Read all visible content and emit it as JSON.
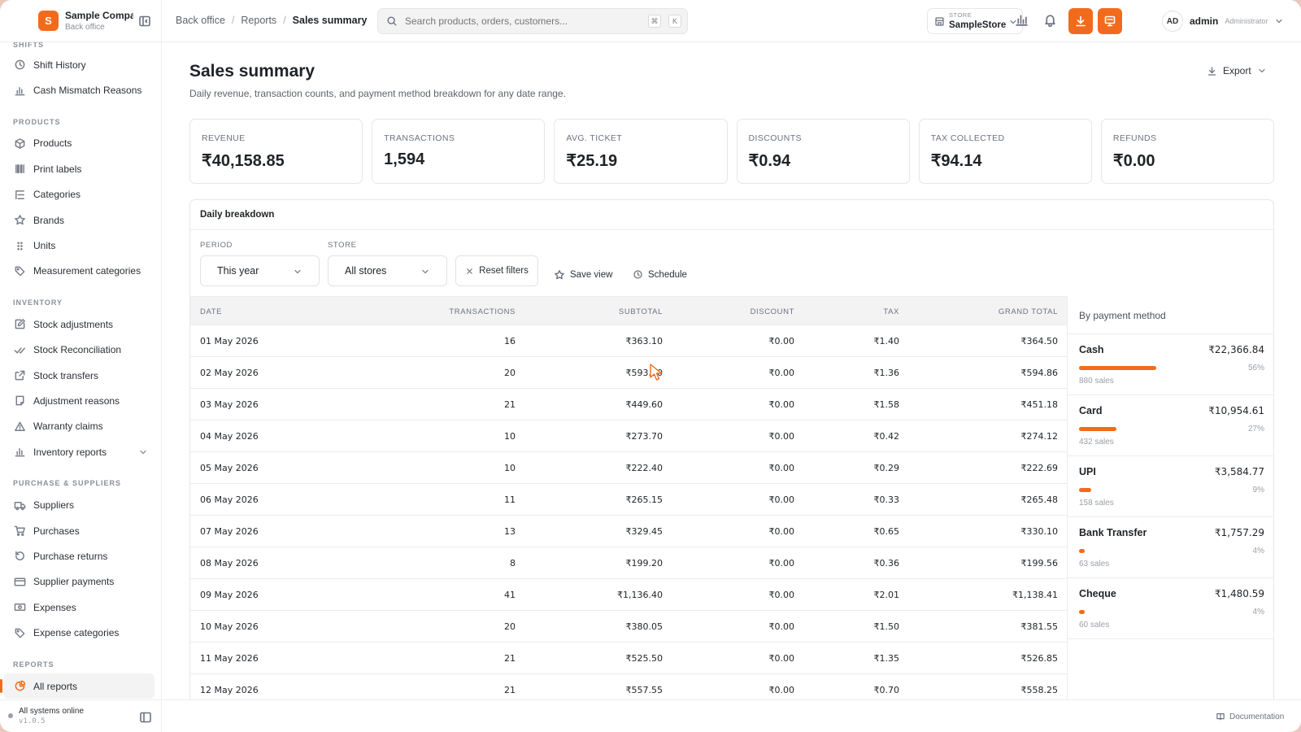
{
  "brand": {
    "initial": "S",
    "name": "Sample Company",
    "sub": "Back office"
  },
  "sidebar": {
    "sections": [
      {
        "label": "Shifts",
        "items": [
          {
            "label": "Shift History",
            "icon": "clock-icon"
          },
          {
            "label": "Cash Mismatch Reasons",
            "icon": "bar-chart-icon"
          }
        ]
      },
      {
        "label": "Products",
        "items": [
          {
            "label": "Products",
            "icon": "box-icon"
          },
          {
            "label": "Print labels",
            "icon": "barcode-icon"
          },
          {
            "label": "Categories",
            "icon": "list-tree-icon"
          },
          {
            "label": "Brands",
            "icon": "star-icon"
          },
          {
            "label": "Units",
            "icon": "grid-dots-icon"
          },
          {
            "label": "Measurement categories",
            "icon": "tag-icon"
          }
        ]
      },
      {
        "label": "Inventory",
        "items": [
          {
            "label": "Stock adjustments",
            "icon": "edit-icon"
          },
          {
            "label": "Stock Reconciliation",
            "icon": "check-check-icon"
          },
          {
            "label": "Stock transfers",
            "icon": "external-link-icon"
          },
          {
            "label": "Adjustment reasons",
            "icon": "note-icon"
          },
          {
            "label": "Warranty claims",
            "icon": "warning-icon"
          },
          {
            "label": "Inventory reports",
            "icon": "bar-chart-icon",
            "expandable": true
          }
        ]
      },
      {
        "label": "Purchase & Suppliers",
        "items": [
          {
            "label": "Suppliers",
            "icon": "truck-icon"
          },
          {
            "label": "Purchases",
            "icon": "cart-icon"
          },
          {
            "label": "Purchase returns",
            "icon": "undo-icon"
          },
          {
            "label": "Supplier payments",
            "icon": "card-icon"
          },
          {
            "label": "Expenses",
            "icon": "banknote-icon"
          },
          {
            "label": "Expense categories",
            "icon": "tag-icon"
          }
        ]
      },
      {
        "label": "Reports",
        "items": [
          {
            "label": "All reports",
            "icon": "pie-chart-icon",
            "active": true
          }
        ]
      }
    ],
    "status": {
      "text": "All systems online",
      "version": "v1.0.5"
    }
  },
  "topbar": {
    "breadcrumb": [
      "Back office",
      "Reports",
      "Sales summary"
    ],
    "search_placeholder": "Search products, orders, customers...",
    "shortcut": [
      "⌘",
      "K"
    ],
    "store": {
      "label": "STORE",
      "value": "SampleStore"
    },
    "user": {
      "initials": "AD",
      "name": "admin",
      "role": "Administrator"
    }
  },
  "page": {
    "title": "Sales summary",
    "description": "Daily revenue, transaction counts, and payment method breakdown for any date range.",
    "export_label": "Export"
  },
  "kpis": [
    {
      "label": "REVENUE",
      "value": "₹40,158.85"
    },
    {
      "label": "TRANSACTIONS",
      "value": "1,594"
    },
    {
      "label": "AVG. TICKET",
      "value": "₹25.19"
    },
    {
      "label": "DISCOUNTS",
      "value": "₹0.94"
    },
    {
      "label": "TAX COLLECTED",
      "value": "₹94.14"
    },
    {
      "label": "REFUNDS",
      "value": "₹0.00"
    }
  ],
  "breakdown": {
    "title": "Daily breakdown",
    "filters": {
      "period_label": "PERIOD",
      "period_value": "This year",
      "store_label": "STORE",
      "store_value": "All stores",
      "reset_label": "Reset filters",
      "save_view_label": "Save view",
      "schedule_label": "Schedule"
    },
    "columns": [
      "DATE",
      "TRANSACTIONS",
      "SUBTOTAL",
      "DISCOUNT",
      "TAX",
      "GRAND TOTAL"
    ],
    "rows": [
      [
        "01 May 2026",
        "16",
        "₹363.10",
        "₹0.00",
        "₹1.40",
        "₹364.50"
      ],
      [
        "02 May 2026",
        "20",
        "₹593.50",
        "₹0.00",
        "₹1.36",
        "₹594.86"
      ],
      [
        "03 May 2026",
        "21",
        "₹449.60",
        "₹0.00",
        "₹1.58",
        "₹451.18"
      ],
      [
        "04 May 2026",
        "10",
        "₹273.70",
        "₹0.00",
        "₹0.42",
        "₹274.12"
      ],
      [
        "05 May 2026",
        "10",
        "₹222.40",
        "₹0.00",
        "₹0.29",
        "₹222.69"
      ],
      [
        "06 May 2026",
        "11",
        "₹265.15",
        "₹0.00",
        "₹0.33",
        "₹265.48"
      ],
      [
        "07 May 2026",
        "13",
        "₹329.45",
        "₹0.00",
        "₹0.65",
        "₹330.10"
      ],
      [
        "08 May 2026",
        "8",
        "₹199.20",
        "₹0.00",
        "₹0.36",
        "₹199.56"
      ],
      [
        "09 May 2026",
        "41",
        "₹1,136.40",
        "₹0.00",
        "₹2.01",
        "₹1,138.41"
      ],
      [
        "10 May 2026",
        "20",
        "₹380.05",
        "₹0.00",
        "₹1.50",
        "₹381.55"
      ],
      [
        "11 May 2026",
        "21",
        "₹525.50",
        "₹0.00",
        "₹1.35",
        "₹526.85"
      ],
      [
        "12 May 2026",
        "21",
        "₹557.55",
        "₹0.00",
        "₹0.70",
        "₹558.25"
      ]
    ],
    "payment_title": "By payment method",
    "payments": [
      {
        "name": "Cash",
        "amount": "₹22,366.84",
        "pct": "56%",
        "share": 0.56,
        "sales": "880 sales"
      },
      {
        "name": "Card",
        "amount": "₹10,954.61",
        "pct": "27%",
        "share": 0.27,
        "sales": "432 sales"
      },
      {
        "name": "UPI",
        "amount": "₹3,584.77",
        "pct": "9%",
        "share": 0.09,
        "sales": "158 sales"
      },
      {
        "name": "Bank Transfer",
        "amount": "₹1,757.29",
        "pct": "4%",
        "share": 0.04,
        "sales": "63 sales"
      },
      {
        "name": "Cheque",
        "amount": "₹1,480.59",
        "pct": "4%",
        "share": 0.04,
        "sales": "60 sales"
      }
    ]
  },
  "footer": {
    "documentation": "Documentation"
  },
  "colors": {
    "accent": "#f26b1d"
  }
}
